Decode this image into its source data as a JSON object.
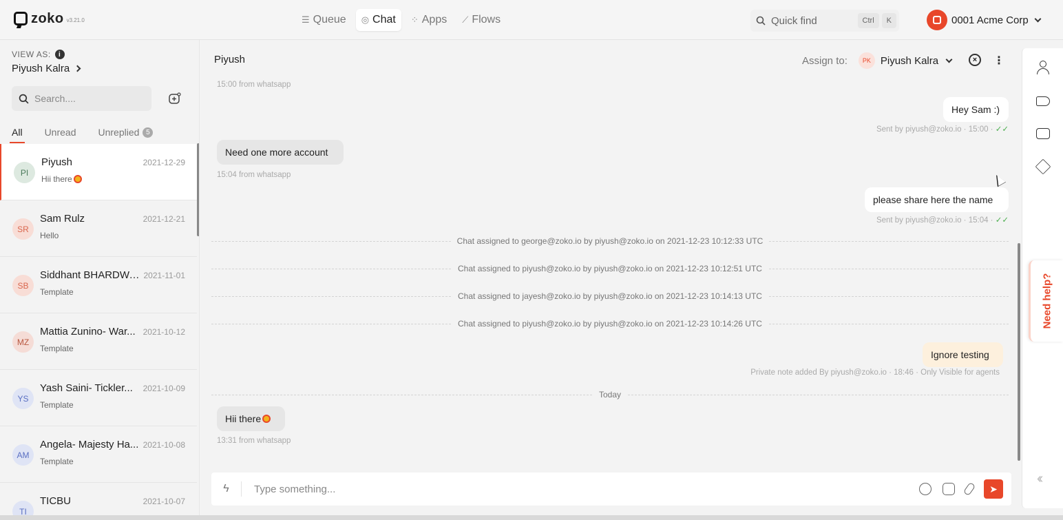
{
  "app": {
    "logo_text": "zoko",
    "version": "v3.21.0"
  },
  "nav": [
    {
      "label": "Queue",
      "icon": "queue-icon"
    },
    {
      "label": "Chat",
      "icon": "chat-icon",
      "active": true
    },
    {
      "label": "Apps",
      "icon": "apps-grid-icon"
    },
    {
      "label": "Flows",
      "icon": "flows-icon"
    }
  ],
  "quick_find": {
    "label": "Quick find",
    "shortcut_1": "Ctrl",
    "shortcut_2": "K"
  },
  "account": {
    "name": "0001 Acme Corp"
  },
  "sidebar": {
    "view_as_label": "VIEW AS:",
    "view_as_info": "i",
    "view_as_user": "Piyush Kalra",
    "search_placeholder": "Search....",
    "tabs": [
      {
        "label": "All",
        "active": true
      },
      {
        "label": "Unread"
      },
      {
        "label": "Unreplied",
        "badge": "5"
      }
    ],
    "conversations": [
      {
        "initials": "PI",
        "name": "Piyush",
        "date": "2021-12-29",
        "preview": "Hii there",
        "emoji": true,
        "active": true,
        "avatar_bg": "#dde9e0",
        "avatar_fg": "#4a7a5a"
      },
      {
        "initials": "SR",
        "name": "Sam Rulz",
        "date": "2021-12-21",
        "preview": "Hello",
        "avatar_bg": "#f8ddd6",
        "avatar_fg": "#d9664d"
      },
      {
        "initials": "SB",
        "name": "Siddhant BHARDWA...",
        "date": "2021-11-01",
        "preview": "Template",
        "avatar_bg": "#f8ddd6",
        "avatar_fg": "#d9664d"
      },
      {
        "initials": "MZ",
        "name": "Mattia Zunino- War...",
        "date": "2021-10-12",
        "preview": "Template",
        "avatar_bg": "#f5dcd6",
        "avatar_fg": "#b8573f"
      },
      {
        "initials": "YS",
        "name": "Yash Saini- Tickler...",
        "date": "2021-10-09",
        "preview": "Template",
        "avatar_bg": "#dfe4f5",
        "avatar_fg": "#5a6fc2"
      },
      {
        "initials": "AM",
        "name": "Angela- Majesty Ha...",
        "date": "2021-10-08",
        "preview": "Template",
        "avatar_bg": "#dfe4f5",
        "avatar_fg": "#5a6fc2"
      },
      {
        "initials": "TI",
        "name": "TICBU",
        "date": "2021-10-07",
        "preview": "",
        "avatar_bg": "#dfe4f5",
        "avatar_fg": "#5a6fc2"
      }
    ]
  },
  "chat": {
    "contact_name": "Piyush",
    "assign_label": "Assign to:",
    "assignee_initials": "PK",
    "assignee_name": "Piyush Kalra",
    "messages": {
      "m0_meta": "15:00 from whatsapp",
      "m1_text": "Hey Sam :)",
      "m1_meta": "Sent by piyush@zoko.io · 15:00 ·",
      "m2_text": "Need one more account",
      "m2_meta": "15:04 from whatsapp",
      "m3_text": "please share here the name",
      "m3_meta": "Sent by piyush@zoko.io · 15:04 ·",
      "sys1": "Chat assigned to george@zoko.io by piyush@zoko.io on 2021-12-23 10:12:33 UTC",
      "sys2": "Chat assigned to piyush@zoko.io by piyush@zoko.io on 2021-12-23 10:12:51 UTC",
      "sys3": "Chat assigned to jayesh@zoko.io by piyush@zoko.io on 2021-12-23 10:14:13 UTC",
      "sys4": "Chat assigned to piyush@zoko.io by piyush@zoko.io on 2021-12-23 10:14:26 UTC",
      "note_text": "Ignore testing",
      "note_meta": "Private note added By piyush@zoko.io · 18:46 · Only Visible for agents",
      "divider": "Today",
      "m4_text": "Hii there",
      "m4_meta": "13:31 from whatsapp"
    },
    "ticks": "✓✓",
    "composer_placeholder": "Type something..."
  },
  "right_rail": {
    "need_help": "Need help?"
  },
  "colors": {
    "accent": "#e8472a",
    "read_ticks": "#4caf50"
  }
}
